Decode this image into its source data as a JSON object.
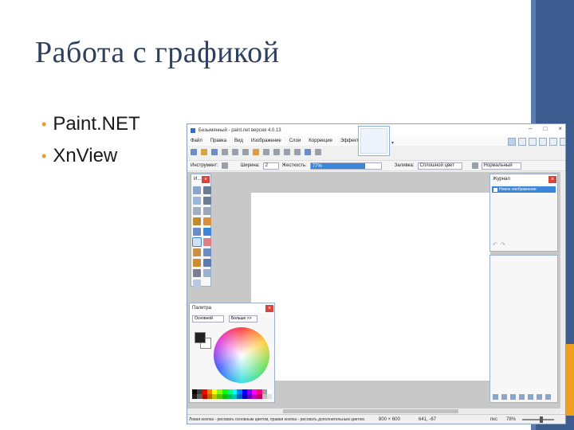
{
  "slide": {
    "title": "Работа с графикой",
    "bullets": [
      "Paint.NET",
      "XnView"
    ],
    "accent_color": "#e0a020",
    "bar_color": "#3c5c8f"
  },
  "window": {
    "title": "Безымянный - paint.net версия 4.0.13",
    "controls": [
      "–",
      "□",
      "×"
    ],
    "menu": [
      "Файл",
      "Правка",
      "Вид",
      "Изображение",
      "Слои",
      "Коррекция",
      "Эффекты"
    ],
    "toolbar": {
      "tool_label": "Инструмент:",
      "width_label": "Ширина:",
      "width_value": "2",
      "hardness_label": "Жесткость:",
      "hardness_value": "77%",
      "hardness_fraction": 0.77,
      "fill_label": "Заливка:",
      "fill_value": "Сплошной цвет",
      "blend_value": "Нормальный"
    },
    "status": {
      "hint": "Левая кнопка - рисовать основным цветом, правая кнопка - рисовать дополнительным цветом.",
      "size": "800 × 600",
      "cursor": "641, -67",
      "units": "пкс",
      "zoom": "78%"
    }
  },
  "panels": {
    "tools_title": "И...",
    "history_title": "Журнал",
    "history_items": [
      "Новое изображение"
    ],
    "palette_title": "Палитра",
    "palette_mode": "Основной",
    "palette_more": "Больше >>",
    "colors": {
      "primary": "#222222",
      "secondary": "#ffffff",
      "highlight": "#3a86d8",
      "close": "#d8433a"
    }
  }
}
